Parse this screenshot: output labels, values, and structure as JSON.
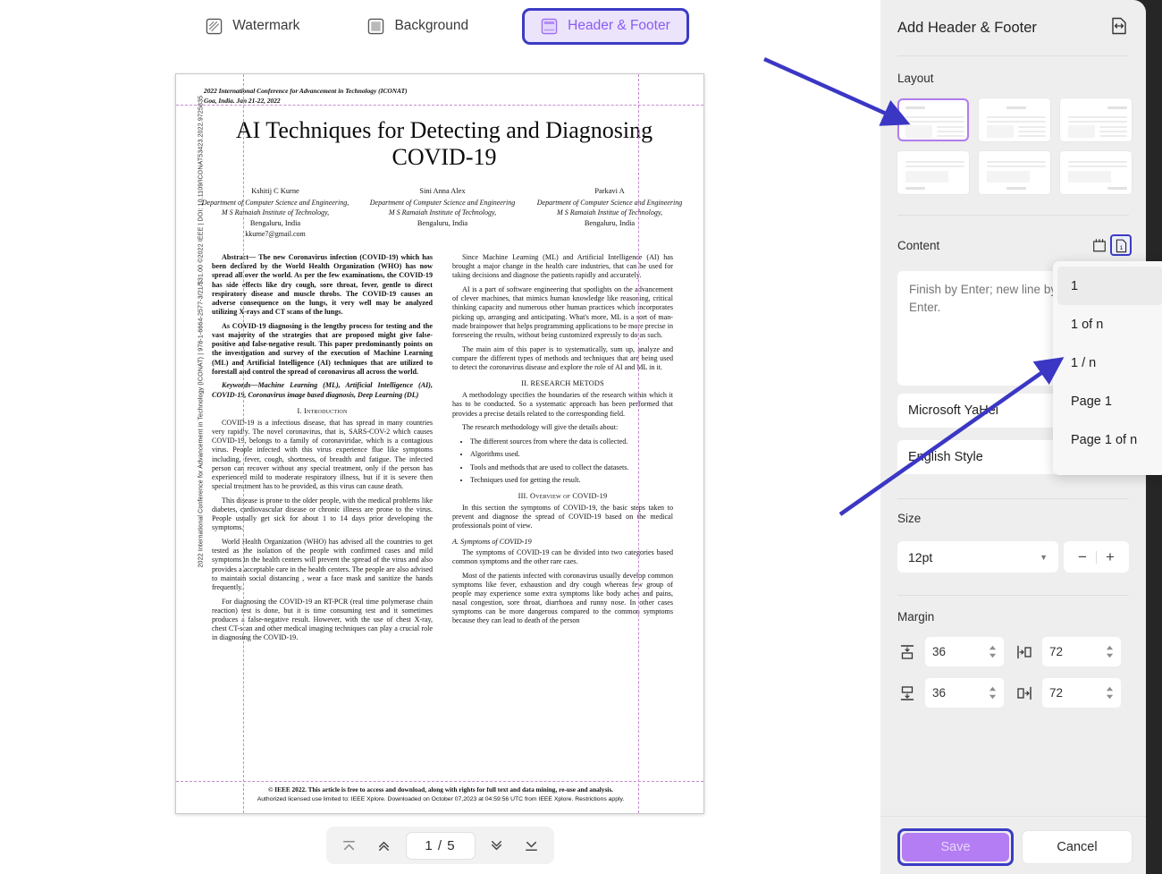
{
  "tabs": [
    {
      "label": "Watermark",
      "icon": "watermark-icon",
      "active": false
    },
    {
      "label": "Background",
      "icon": "background-icon",
      "active": false
    },
    {
      "label": "Header & Footer",
      "icon": "header-footer-icon",
      "active": true
    }
  ],
  "document": {
    "side_stamp": "2022 International Conference for Advancement in Technology (ICONAT) | 978-1-6664-2577-3/21/$31.00 ©2022 IEEE | DOI: 10.1109/ICONAT53423.2022.9725835",
    "conference_line1": "2022 International Conference for Advancement in Technology (ICONAT)",
    "conference_line2": "Goa, India. Jan 21-22, 2022",
    "title": "AI Techniques for Detecting and Diagnosing COVID-19",
    "authors": [
      {
        "name": "Kshitij C Kurne",
        "affil1": "Department of Computer Science and Engineering,",
        "affil2": "M S Ramaiah Institute of Technology,",
        "affil3": "Bengaluru, India",
        "email": "kkurne7@gmail.com"
      },
      {
        "name": "Sini Anna Alex",
        "affil1": "Department of Computer Science and Engineering",
        "affil2": "M S Ramaiah Institute of Technology,",
        "affil3": "Bengaluru, India",
        "email": ""
      },
      {
        "name": "Parkavi A",
        "affil1": "Department of Computer Science and Engineering",
        "affil2": "M S Ramaiah Institue of Technology,",
        "affil3": "Bengaluru, India",
        "email": ""
      }
    ],
    "left_column": {
      "abstract": "Abstract— The new Coronavirus infection (COVID-19) which has been declared by the World Health Organization (WHO) has now spread all over the world. As per the few examinations, the COVID-19 has side effects like dry cough, sore throat, fever, gentle to direct respiratory disease and muscle throbs. The COVID-19 causes an adverse consequence on the lungs, it very well may be analyzed utilizing X-rays and CT scans of the lungs.",
      "abstract2": "As COVID-19 diagnosing is the lengthy process for testing and the vast majority of the strategies that are proposed might give false-positive and false-negative result. This paper predominantly points on the investigation and survey of the execution of Machine Learning (ML) and Artificial Intelligence (AI) techniques that are utilized to forestall and control the spread of coronavirus all across the world.",
      "keywords": "Keywords—Machine Learning (ML), Artificial Intelligence (AI), COVID-19, Coronavirus image based diagnosis, Deep Learning (DL)",
      "heading_intro": "I.    Introduction",
      "p1": "COVID-19 is a infectious disease, that has spread in many countries very rapidly. The novel coronavirus, that is, SARS-COV-2 which causes COVID-19, belongs to a family of coronaviridae, which is a contagious virus. People infected with this virus experience flue like symptoms including, fever, cough, shortness, of breadth and fatigue. The infected person can recover without any special treatment, only if the person has experienced mild to moderate respiratory illness, but if it is severe then special treatment has to be provided, as this virus can cause death.",
      "p2": "This disease is prone to the older people, with the medical problems like diabetes, cardiovascular disease or chronic illness are prone to the virus. People usually get sick for about 1 to 14 days prior developing the symptoms.",
      "p3": "World Health Organization (WHO) has advised all the countries to get tested as the isolation of the people with confirmed cases and mild symptoms in the health centers will prevent the spread of the virus and also provides a acceptable care in the health centers. The people are also advised to maintain social distancing , wear a face mask and sanitize the hands frequently.",
      "p4": "For diagnosing the COVID-19 an RT-PCR (real time polymerase chain reaction) test is done, but it is time consuming test and it sometimes produces a false-negative result. However, with the use of chest X-ray, chest CT-scan and other medical imaging techniques can play a crucial role in diagnosing the COVID-19."
    },
    "right_column": {
      "p1": "Since Machine Learning (ML) and Artificial Intelligence (AI) has brought a major change in the health care industries, that can be used for taking decisions and diagnose the patients rapidly and accurately.",
      "p2": "AI is a part of software engineering that spotlights on the advancement of clever machines, that mimics human knowledge like reasoning, critical thinking capacity and numerous other human practices which incorporates picking up, arranging and anticipating. What's more, ML is a sort of man-made brainpower that helps programming applications to be more precise in foreseeing the results, without being customized expressly to do as such.",
      "p3": "The main aim of this paper is to systematically, sum up, analyze and compare the different types of methods and techniques that are being used to detect the coronavirus disease and explore the role of AI and ML in it.",
      "heading_methods": "II.    RESEARCH METODS",
      "p4": "A methodology specifies the boundaries of the research within which it has to be conducted. So a systematic approach has been performed that provides a precise details related to the corresponding field.",
      "p5": "The research methodology will give the details about:",
      "bullets": [
        "The different sources from where the data is collected.",
        "Algorithms used.",
        "Tools and methods that are used to collect the datasets.",
        "Techniques used for getting the result."
      ],
      "heading_overview": "III.    Overview of COVID-19",
      "p6": "In this section the symptoms of COVID-19, the basic steps taken to prevent and diagnose the spread of COVID-19 based on the medical professionals point of view.",
      "subheading_symptoms": "A.   Symptoms of COVID-19",
      "p7": "The symptoms of COVID-19 can be divided into two categories based common symptoms and the other rare caes.",
      "p8": "Most of the patients infected with coronavirus usually develop common symptoms like fever, exhaustion and dry cough whereas few group of people may experience some extra symptoms like body aches and pains, nasal congestion, sore throat, diarrhoea and runny nose. In other cases symptoms can be more dangerous compared to the common symptoms because they can lead to death of the person"
    },
    "footnote_line1": "© IEEE 2022. This article is free to access and download, along with rights for full text and data mining, re-use and analysis.",
    "footnote_line2": "Authorized licensed use limited to: IEEE Xplore. Downloaded on October 07,2023 at 04:59:56 UTC from IEEE Xplore.  Restrictions apply."
  },
  "pagenav": {
    "first_icon": "first-page-icon",
    "prev_icon": "previous-page-icon",
    "indicator": "1 / 5",
    "next_icon": "next-page-icon",
    "last_icon": "last-page-icon"
  },
  "panel": {
    "title": "Add Header & Footer",
    "expand_icon": "expand-page-icon",
    "layout_label": "Layout",
    "layout_options": [
      {
        "name": "header-left",
        "selected": true
      },
      {
        "name": "header-center",
        "selected": false
      },
      {
        "name": "header-right",
        "selected": false
      },
      {
        "name": "footer-left",
        "selected": false
      },
      {
        "name": "footer-center",
        "selected": false
      },
      {
        "name": "footer-right",
        "selected": false
      }
    ],
    "content_label": "Content",
    "date_icon": "calendar-date-icon",
    "pagenumber_icon": "page-number-icon",
    "textarea_placeholder": "Finish by Enter; new line by Shift + Enter.",
    "textarea_value": "",
    "font_family": "Microsoft YaHei",
    "font_style": "English Style",
    "size_label": "Size",
    "size_value": "12pt",
    "minus_label": "−",
    "plus_label": "+",
    "margin_label": "Margin",
    "margin_top": "36",
    "margin_bottom": "36",
    "margin_left": "72",
    "margin_right": "72",
    "save_label": "Save",
    "cancel_label": "Cancel"
  },
  "dropdown": {
    "items": [
      "1",
      "1 of n",
      "1 / n",
      "Page 1",
      "Page 1 of n"
    ],
    "highlighted_index": 0
  },
  "colors": {
    "accent_purple": "#8a5cf5",
    "highlight_blue": "#3b3bc4",
    "save_button": "#b47df3",
    "panel_bg": "#eeeeee",
    "guide_pink": "#c58ad0"
  }
}
